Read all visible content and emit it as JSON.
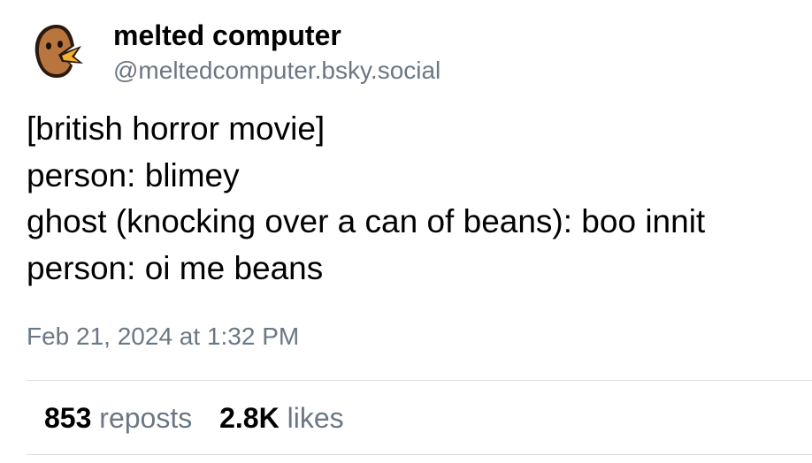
{
  "post": {
    "author": {
      "display_name": "melted computer",
      "handle": "@meltedcomputer.bsky.social",
      "avatar_icon": "duck-avatar-icon"
    },
    "lines": [
      "[british horror movie]",
      "person: blimey",
      "ghost (knocking over a can of beans): boo innit",
      "person: oi me beans"
    ],
    "timestamp": "Feb 21, 2024 at 1:32 PM",
    "stats": {
      "reposts_count": "853",
      "reposts_label": "reposts",
      "likes_count": "2.8K",
      "likes_label": "likes"
    }
  },
  "colors": {
    "text": "#000000",
    "muted": "#6b7785",
    "divider": "#dcdfe4",
    "avatar_skin": "#b8753e",
    "avatar_beak": "#f2b32a"
  }
}
